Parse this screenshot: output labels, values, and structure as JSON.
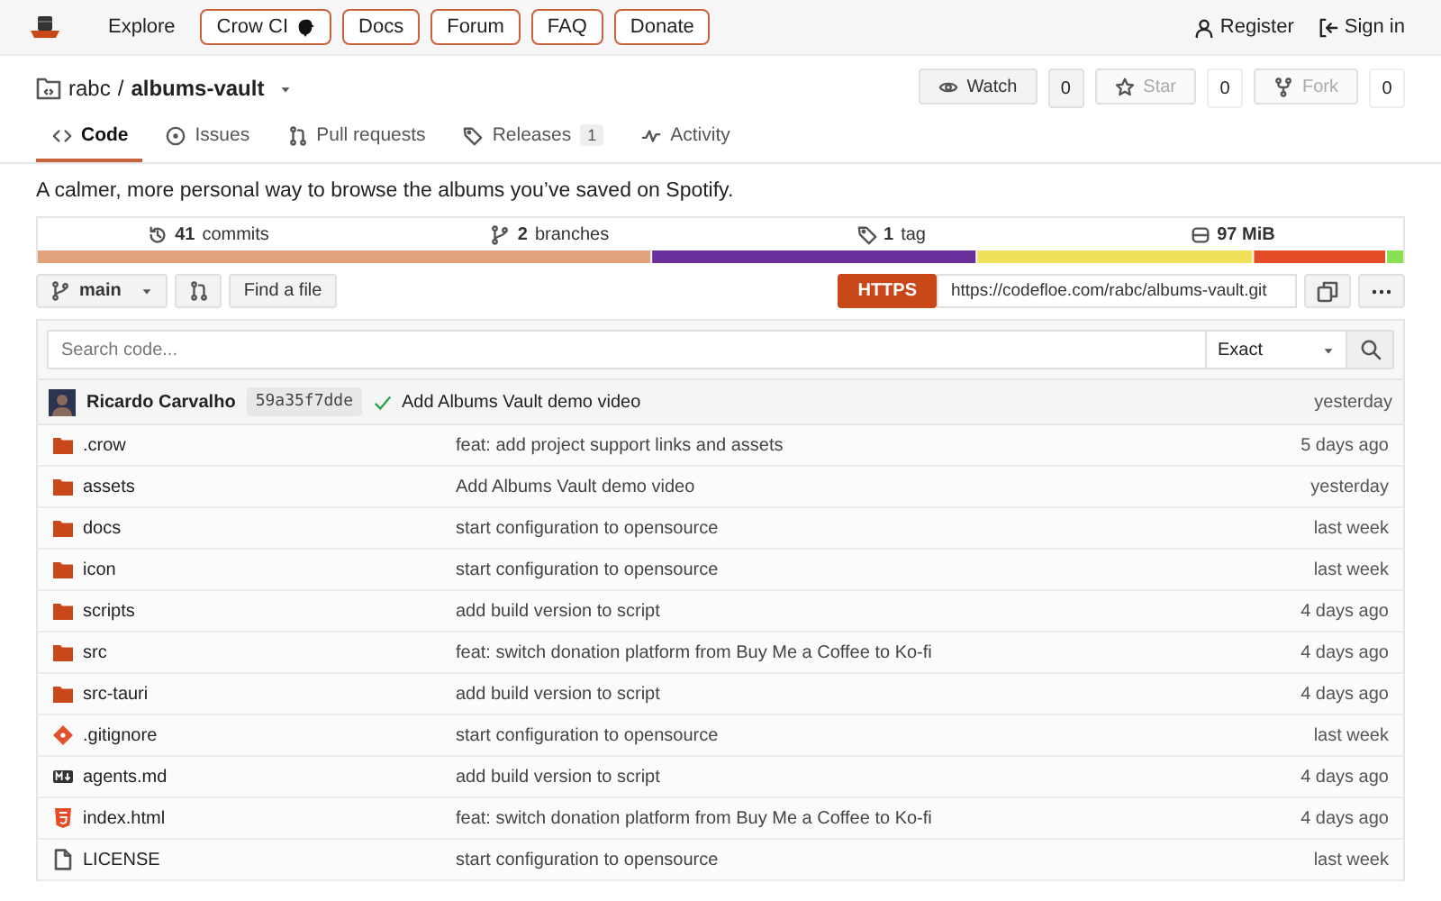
{
  "nav": {
    "links": [
      {
        "label": "Explore",
        "kind": "plain",
        "icon": false
      },
      {
        "label": "Crow CI",
        "kind": "outlined",
        "icon": true
      },
      {
        "label": "Docs",
        "kind": "outlined",
        "icon": false
      },
      {
        "label": "Forum",
        "kind": "outlined",
        "icon": false
      },
      {
        "label": "FAQ",
        "kind": "outlined",
        "icon": false
      },
      {
        "label": "Donate",
        "kind": "outlined",
        "icon": false
      }
    ],
    "account": [
      {
        "label": "Register",
        "kind": "register"
      },
      {
        "label": "Sign in",
        "kind": "signin"
      }
    ]
  },
  "repo": {
    "owner": "rabc",
    "separator": "/",
    "name": "albums-vault",
    "actions": [
      {
        "label": "Watch",
        "count": "0",
        "kind": "watch",
        "disabled": false
      },
      {
        "label": "Star",
        "count": "0",
        "kind": "star",
        "disabled": true
      },
      {
        "label": "Fork",
        "count": "0",
        "kind": "fork",
        "disabled": true
      }
    ]
  },
  "tabs": [
    {
      "label": "Code",
      "kind": "code",
      "selected": true
    },
    {
      "label": "Issues",
      "kind": "issues",
      "selected": false
    },
    {
      "label": "Pull requests",
      "kind": "pulls",
      "selected": false
    },
    {
      "label": "Releases",
      "kind": "tag",
      "selected": false,
      "count": "1"
    },
    {
      "label": "Activity",
      "kind": "activity",
      "selected": false
    }
  ],
  "description": "A calmer, more personal way to browse the albums you’ve saved on Spotify.",
  "stats": [
    {
      "value": "41",
      "label": "commits",
      "kind": "history"
    },
    {
      "value": "2",
      "label": "branches",
      "kind": "branch"
    },
    {
      "value": "1",
      "label": "tag",
      "kind": "tag"
    },
    {
      "value": "97 MiB",
      "kind": "disk"
    }
  ],
  "toolbar": {
    "branch": "main",
    "find_file": "Find a file",
    "clone_protocol": "HTTPS",
    "clone_url": "https://codefloe.com/rabc/albums-vault.git"
  },
  "code_search": {
    "placeholder": "Search code...",
    "mode": "Exact"
  },
  "latest_commit": {
    "author": "Ricardo Carvalho",
    "sha": "59a35f7dde",
    "message": "Add Albums Vault demo video",
    "time": "yesterday"
  },
  "files": [
    {
      "name": ".crow",
      "kind": "folder",
      "message": "feat: add project support links and assets",
      "time": "5 days ago"
    },
    {
      "name": "assets",
      "kind": "folder",
      "message": "Add Albums Vault demo video",
      "time": "yesterday"
    },
    {
      "name": "docs",
      "kind": "folder",
      "message": "start configuration to opensource",
      "time": "last week"
    },
    {
      "name": "icon",
      "kind": "folder",
      "message": "start configuration to opensource",
      "time": "last week"
    },
    {
      "name": "scripts",
      "kind": "folder",
      "message": "add build version to script",
      "time": "4 days ago"
    },
    {
      "name": "src",
      "kind": "folder",
      "message": "feat: switch donation platform from Buy Me a Coffee to Ko-fi",
      "time": "4 days ago"
    },
    {
      "name": "src-tauri",
      "kind": "folder",
      "message": "add build version to script",
      "time": "4 days ago"
    },
    {
      "name": ".gitignore",
      "kind": "git",
      "message": "start configuration to opensource",
      "time": "last week"
    },
    {
      "name": "agents.md",
      "kind": "markdown",
      "message": "add build version to script",
      "time": "4 days ago"
    },
    {
      "name": "index.html",
      "kind": "html",
      "message": "feat: switch donation platform from Buy Me a Coffee to Ko-fi",
      "time": "4 days ago"
    },
    {
      "name": "LICENSE",
      "kind": "file",
      "message": "start configuration to opensource",
      "time": "last week"
    }
  ]
}
